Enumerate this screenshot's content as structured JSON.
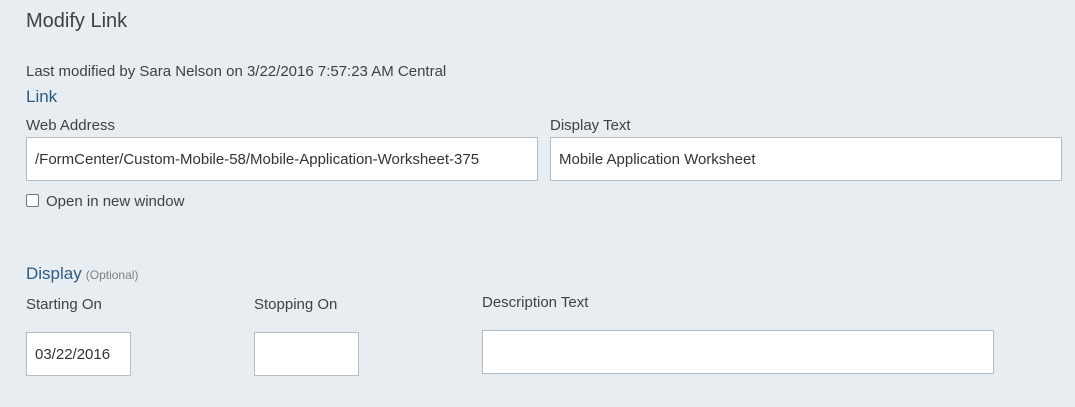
{
  "page": {
    "title": "Modify Link",
    "last_modified": "Last modified by Sara Nelson on 3/22/2016 7:57:23 AM Central"
  },
  "link": {
    "section_title": "Link",
    "web_address": {
      "label": "Web Address",
      "value": "/FormCenter/Custom-Mobile-58/Mobile-Application-Worksheet-375"
    },
    "display_text": {
      "label": "Display Text",
      "value": "Mobile Application Worksheet"
    },
    "open_new_window": {
      "label": "Open in new window",
      "checked": false
    }
  },
  "display": {
    "section_title": "Display",
    "optional_tag": "(Optional)",
    "starting_on": {
      "label": "Starting On",
      "value": "03/22/2016"
    },
    "stopping_on": {
      "label": "Stopping On",
      "value": ""
    },
    "description_text": {
      "label": "Description Text",
      "value": ""
    }
  }
}
